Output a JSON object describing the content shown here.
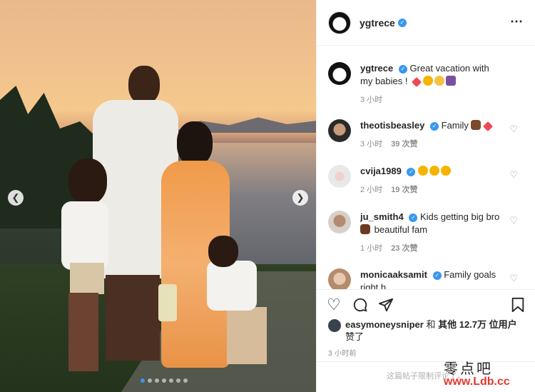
{
  "post": {
    "username": "ygtrece",
    "more_icon": "⋯",
    "carousel": {
      "active_index": 0,
      "count": 7
    }
  },
  "caption": {
    "username": "ygtrece",
    "text": "Great vacation with my babies !",
    "emojis": [
      "heart",
      "star-eyes",
      "smiling-hearts",
      "family"
    ],
    "time": "3 小时"
  },
  "comments": [
    {
      "username": "theotisbeasley",
      "text": "Family",
      "emojis": [
        "flexed-biceps",
        "heart"
      ],
      "time": "3 小时",
      "likes": "39 次赞"
    },
    {
      "username": "cvija1989",
      "text": "",
      "emojis": [
        "star-eyes",
        "star-eyes",
        "star-eyes"
      ],
      "time": "2 小时",
      "likes": "19 次赞"
    },
    {
      "username": "ju_smith4",
      "text": "Kids getting big bro",
      "text2": "beautiful fam",
      "emojis": [
        "mother"
      ],
      "time": "1 小时",
      "likes": "23 次赞"
    },
    {
      "username": "monicaaksamit",
      "text": "Family goals",
      "text2": "right h",
      "emojis": [],
      "time": "",
      "likes": ""
    }
  ],
  "likes": {
    "user": "easymoneysniper",
    "joiner": "和",
    "others": "其他 12.7万 位用户",
    "suffix": "赞了"
  },
  "timestamp": "3 小时前",
  "comment_limit": "这篇帖子限制评论了。",
  "watermark": {
    "cn": "零点吧",
    "url": "www.Ldb.cc"
  },
  "colors": {
    "verified": "#3897f0",
    "heart": "#ed4956",
    "active_dot": "#3897f0"
  }
}
